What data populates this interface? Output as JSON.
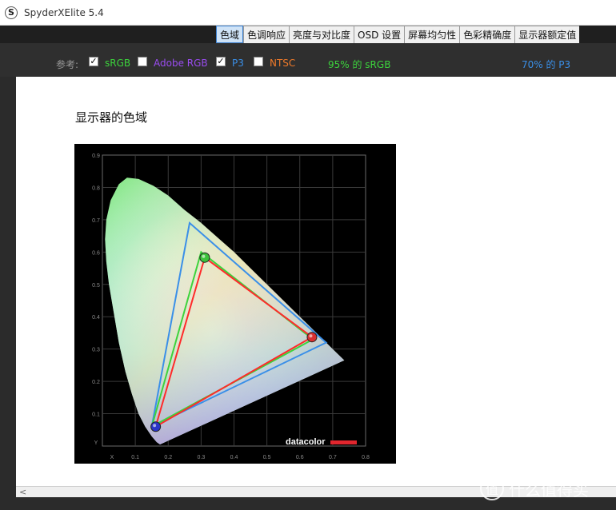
{
  "window": {
    "title": "SpyderXElite 5.4",
    "icon": "S"
  },
  "tabs": [
    {
      "label": "色域",
      "active": true
    },
    {
      "label": "色调响应",
      "active": false
    },
    {
      "label": "亮度与对比度",
      "active": false
    },
    {
      "label": "OSD 设置",
      "active": false
    },
    {
      "label": "屏幕均匀性",
      "active": false
    },
    {
      "label": "色彩精确度",
      "active": false
    },
    {
      "label": "显示器额定值",
      "active": false
    }
  ],
  "reference": {
    "label": "参考:",
    "options": [
      {
        "label": "sRGB",
        "checked": true,
        "color": "#3cd33c",
        "check": "✓"
      },
      {
        "label": "Adobe RGB",
        "checked": false,
        "color": "#9a4cf0",
        "check": ""
      },
      {
        "label": "P3",
        "checked": true,
        "color": "#3a8fe8",
        "check": "✓"
      },
      {
        "label": "NTSC",
        "checked": false,
        "color": "#f07a2a",
        "check": ""
      }
    ]
  },
  "stats": {
    "srgb": {
      "text": "95% 的 sRGB",
      "color": "#3cd33c"
    },
    "p3": {
      "text": "70% 的 P3",
      "color": "#3a8fe8"
    }
  },
  "content": {
    "title": "显示器的色域"
  },
  "chart_data": {
    "type": "scatter",
    "title": "",
    "xlabel": "X",
    "ylabel": "Y",
    "xlim": [
      0,
      0.8
    ],
    "ylim": [
      0,
      0.9
    ],
    "x_ticks": [
      "X",
      "0.1",
      "0.2",
      "0.3",
      "0.4",
      "0.5",
      "0.6",
      "0.7",
      "0.8"
    ],
    "y_ticks": [
      "Y",
      "0.1",
      "0.2",
      "0.3",
      "0.4",
      "0.5",
      "0.6",
      "0.7",
      "0.8",
      "0.9"
    ],
    "series": [
      {
        "name": "sRGB",
        "color": "#3cd33c",
        "points": [
          {
            "x": 0.64,
            "y": 0.33
          },
          {
            "x": 0.3,
            "y": 0.6
          },
          {
            "x": 0.15,
            "y": 0.06
          }
        ]
      },
      {
        "name": "P3",
        "color": "#3a8fe8",
        "points": [
          {
            "x": 0.68,
            "y": 0.32
          },
          {
            "x": 0.265,
            "y": 0.69
          },
          {
            "x": 0.15,
            "y": 0.06
          }
        ]
      },
      {
        "name": "",
        "color": "#ff2a2a",
        "points": [
          {
            "x": 0.637,
            "y": 0.337
          },
          {
            "x": 0.311,
            "y": 0.583
          },
          {
            "x": 0.162,
            "y": 0.06
          }
        ]
      }
    ],
    "grid": true,
    "logo": "datacolor"
  },
  "watermark": {
    "text": "什么值得买",
    "icon": "值"
  }
}
